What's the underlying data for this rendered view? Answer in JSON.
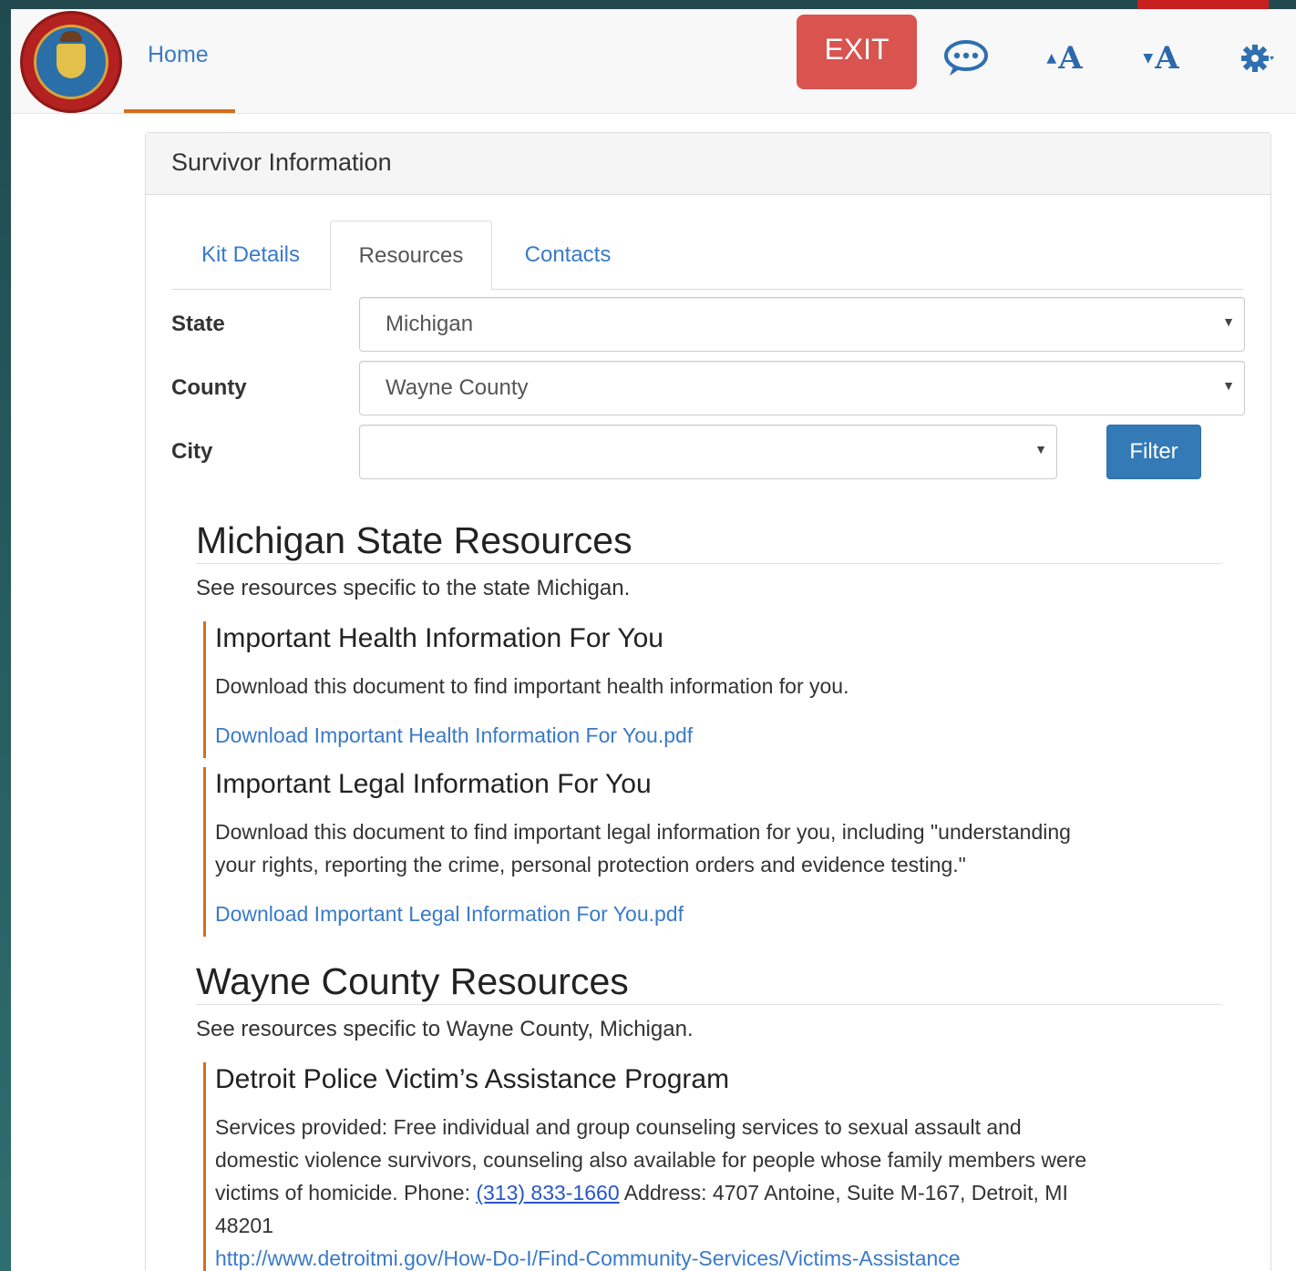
{
  "navbar": {
    "home_label": "Home",
    "exit_label": "EXIT",
    "font_increase_label": "A",
    "font_decrease_label": "A",
    "icons": [
      "state-seal-logo",
      "chat-icon",
      "font-increase-icon",
      "font-decrease-icon",
      "gear-icon"
    ]
  },
  "panel": {
    "title": "Survivor Information",
    "tabs": [
      {
        "label": "Kit Details"
      },
      {
        "label": "Resources"
      },
      {
        "label": "Contacts"
      }
    ]
  },
  "form": {
    "state_label": "State",
    "state_value": "Michigan",
    "county_label": "County",
    "county_value": "Wayne County",
    "city_label": "City",
    "city_value": "",
    "filter_label": "Filter"
  },
  "state_section": {
    "title": "Michigan State Resources",
    "subtitle": "See resources specific to the state Michigan.",
    "resources": [
      {
        "title": "Important Health Information For You",
        "description": "Download this document to find important health information for you.",
        "link": "Download Important Health Information For You.pdf"
      },
      {
        "title": "Important Legal Information For You",
        "description_line1": "Download this document to find important legal information for you, including \"understanding",
        "description_line2": "your rights, reporting the crime, personal protection orders and evidence testing.\"",
        "link": "Download Important Legal Information For You.pdf"
      }
    ]
  },
  "county_section": {
    "title": "Wayne County Resources",
    "subtitle": "See resources specific to Wayne County, Michigan.",
    "resources": [
      {
        "title": "Detroit Police Victim’s Assistance Program",
        "line1": "Services provided: Free individual and group counseling services to sexual assault and",
        "line2": "domestic violence survivors, counseling also available for people whose family members were",
        "line3_prefix": "victims of homicide. Phone: ",
        "phone": "(313) 833-1660",
        "line3_suffix": " Address: 4707 Antoine, Suite M-167, Detroit, MI",
        "line4": "48201",
        "url": "http://www.detroitmi.gov/How-Do-I/Find-Community-Services/Victims-Assistance"
      }
    ]
  },
  "colors": {
    "link": "#3a7ac8",
    "exit": "#d9534f",
    "filter": "#337ab7",
    "accent": "#d46e1b"
  }
}
